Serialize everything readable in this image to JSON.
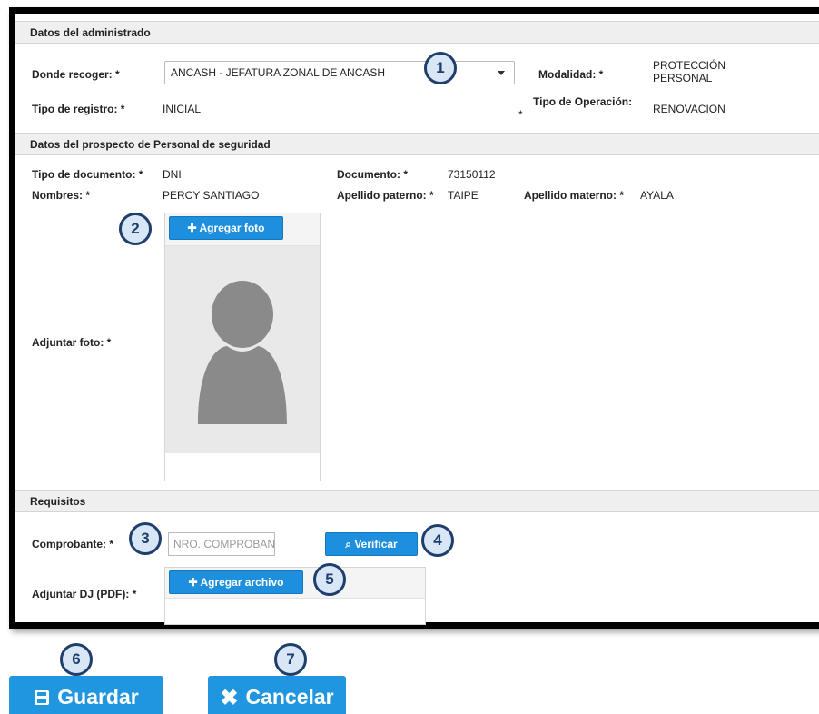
{
  "administrado": {
    "header": "Datos del administrado",
    "donde_recoger_label": "Donde recoger: *",
    "donde_recoger_value": "ANCASH - JEFATURA ZONAL DE ANCASH",
    "modalidad_label": "Modalidad: *",
    "modalidad_value_1": "PROTECCIÓN",
    "modalidad_value_2": "PERSONAL",
    "tipo_registro_label": "Tipo de registro: *",
    "tipo_registro_value": "INICIAL",
    "tipo_operacion_label": "Tipo de Operación:",
    "tipo_operacion_asterisk": "*",
    "tipo_operacion_value": "RENOVACION"
  },
  "prospecto": {
    "header": "Datos del prospecto de Personal de seguridad",
    "tipo_documento_label": "Tipo de documento: *",
    "tipo_documento_value": "DNI",
    "documento_label": "Documento: *",
    "documento_value": "73150112",
    "nombres_label": "Nombres: *",
    "nombres_value": "PERCY SANTIAGO",
    "apellido_paterno_label": "Apellido paterno: *",
    "apellido_paterno_value": "TAIPE",
    "apellido_materno_label": "Apellido materno: *",
    "apellido_materno_value": "AYALA",
    "adjuntar_foto_label": "Adjuntar foto: *",
    "agregar_foto_button": "Agregar foto"
  },
  "requisitos": {
    "header": "Requisitos",
    "comprobante_label": "Comprobante: *",
    "comprobante_placeholder": "NRO. COMPROBANTE",
    "verificar_button": "Verificar",
    "adjuntar_dj_label": "Adjuntar DJ (PDF): *",
    "agregar_archivo_button": "Agregar archivo"
  },
  "actions": {
    "guardar_button": "Guardar",
    "cancelar_button": "Cancelar"
  },
  "badges": [
    "1",
    "2",
    "3",
    "4",
    "5",
    "6",
    "7"
  ],
  "colors": {
    "primary_button": "#1e8fdc",
    "badge_border": "#1f3e6c",
    "badge_fill": "#d8e6f6",
    "section_header_bg": "#efefef"
  },
  "icons": {
    "dropdown": "chevron-down-icon",
    "agregar": "plus-icon",
    "verificar": "search-icon",
    "guardar": "floppy-disk-icon",
    "cancelar": "close-icon",
    "foto_placeholder": "user-silhouette-icon"
  }
}
